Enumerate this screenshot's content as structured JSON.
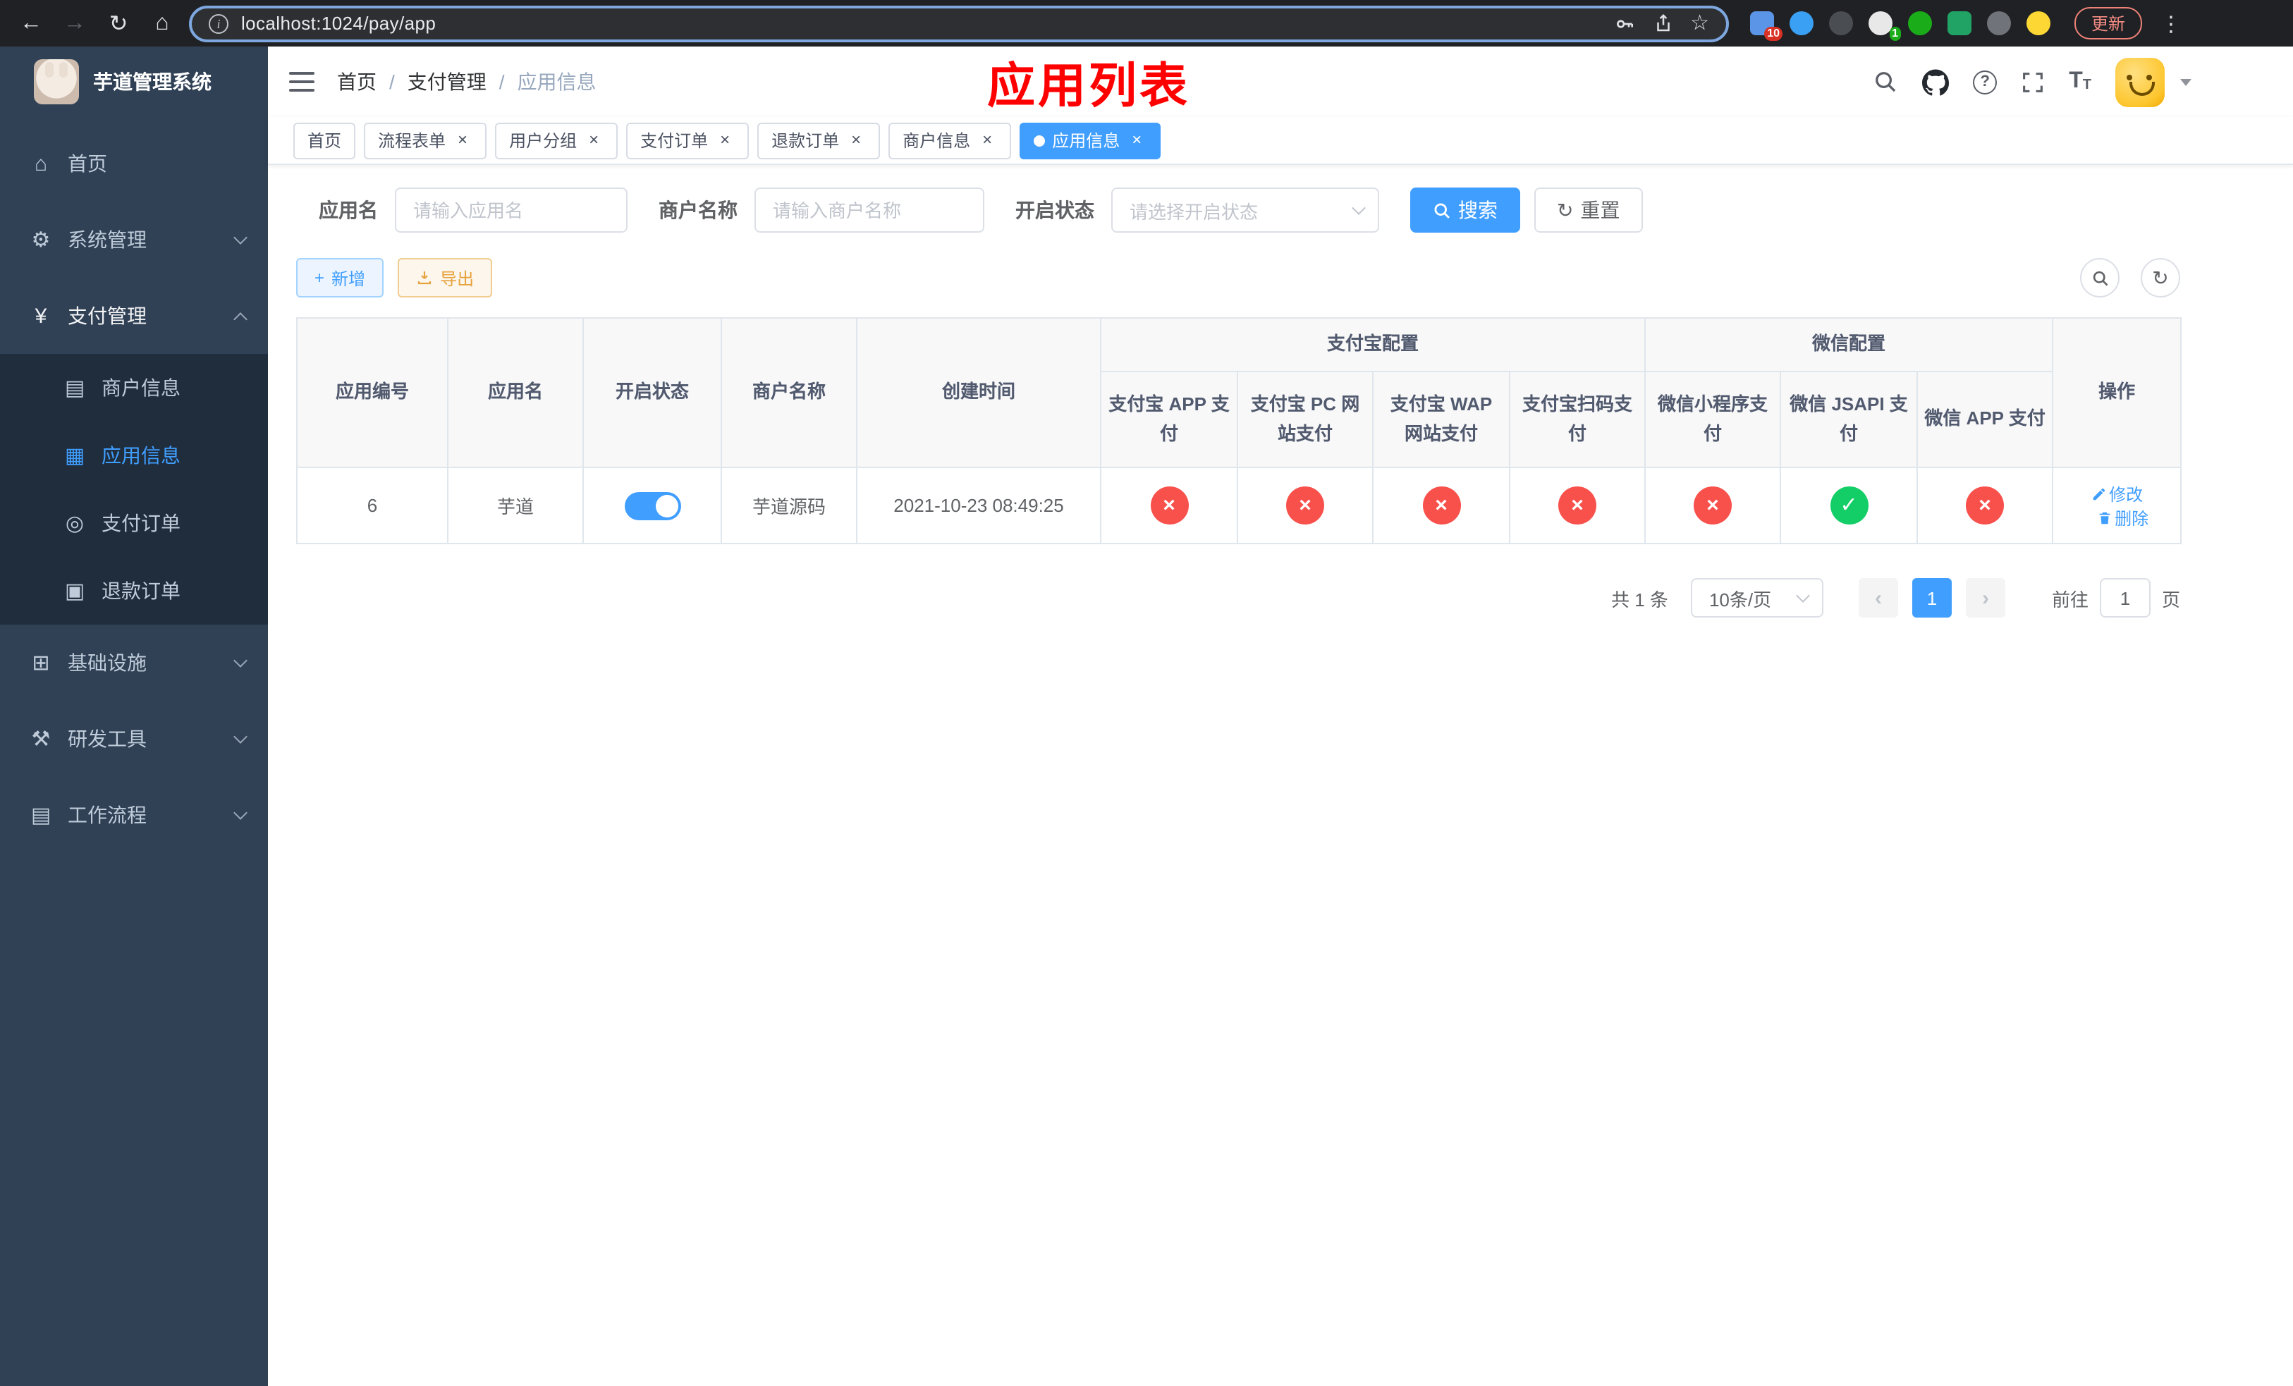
{
  "colors": {
    "accent": "#409EFF",
    "status_red": "#F8514C",
    "status_green": "#13CE66",
    "annotation": "#FF0000",
    "sidebar_bg": "#304156",
    "sidebar_sub_bg": "#1F2D3D"
  },
  "browser": {
    "url": "localhost:1024/pay/app",
    "update_button": "更新",
    "extension_badge_a": "10",
    "extension_badge_b": "1"
  },
  "sidebar": {
    "title": "芋道管理系统",
    "items": [
      {
        "label": "首页"
      },
      {
        "label": "系统管理"
      },
      {
        "label": "支付管理"
      },
      {
        "label": "基础设施"
      },
      {
        "label": "研发工具"
      },
      {
        "label": "工作流程"
      }
    ],
    "payment_submenu": [
      {
        "label": "商户信息"
      },
      {
        "label": "应用信息"
      },
      {
        "label": "支付订单"
      },
      {
        "label": "退款订单"
      }
    ]
  },
  "header": {
    "breadcrumb": [
      "首页",
      "支付管理",
      "应用信息"
    ],
    "annotation": "应用列表"
  },
  "tabs": [
    {
      "label": "首页"
    },
    {
      "label": "流程表单"
    },
    {
      "label": "用户分组"
    },
    {
      "label": "支付订单"
    },
    {
      "label": "退款订单"
    },
    {
      "label": "商户信息"
    },
    {
      "label": "应用信息"
    }
  ],
  "filters": {
    "app_name_label": "应用名",
    "app_name_placeholder": "请输入应用名",
    "merchant_label": "商户名称",
    "merchant_placeholder": "请输入商户名称",
    "status_label": "开启状态",
    "status_placeholder": "请选择开启状态",
    "search_button": "搜索",
    "reset_button": "重置"
  },
  "toolbar": {
    "add_button": "新增",
    "export_button": "导出"
  },
  "table": {
    "headers": {
      "id": "应用编号",
      "name": "应用名",
      "status": "开启状态",
      "merchant": "商户名称",
      "created": "创建时间",
      "alipay_group": "支付宝配置",
      "alipay": [
        "支付宝 APP 支付",
        "支付宝 PC 网站支付",
        "支付宝 WAP 网站支付",
        "支付宝扫码支付"
      ],
      "wechat_group": "微信配置",
      "wechat": [
        "微信小程序支付",
        "微信 JSAPI 支付",
        "微信 APP 支付"
      ],
      "ops": "操作"
    },
    "row": {
      "id": "6",
      "name": "芋道",
      "enabled": true,
      "merchant": "芋道源码",
      "created": "2021-10-23 08:49:25",
      "configs": [
        false,
        false,
        false,
        false,
        false,
        true,
        false
      ],
      "edit_label": "修改",
      "delete_label": "删除"
    }
  },
  "pagination": {
    "total_text": "共 1 条",
    "page_size": "10条/页",
    "current_page": "1",
    "goto_label": "前往",
    "goto_value": "1",
    "page_unit": "页"
  }
}
